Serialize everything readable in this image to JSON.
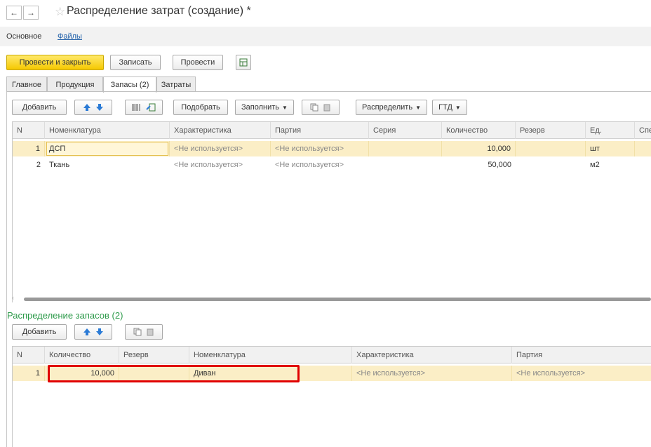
{
  "window": {
    "title": "Распределение затрат (создание) *"
  },
  "nav": {
    "back": "←",
    "forward": "→",
    "main_label": "Основное",
    "files_label": "Файлы"
  },
  "toolbar": {
    "post_close": "Провести и закрыть",
    "save": "Записать",
    "post": "Провести"
  },
  "tabs": [
    {
      "label": "Главное"
    },
    {
      "label": "Продукция"
    },
    {
      "label": "Запасы (2)"
    },
    {
      "label": "Затраты"
    }
  ],
  "stock_toolbar": {
    "add": "Добавить",
    "select": "Подобрать",
    "fill": "Заполнить",
    "distribute": "Распределить",
    "gtd": "ГТД"
  },
  "stock_table": {
    "columns": [
      "N",
      "Номенклатура",
      "Характеристика",
      "Партия",
      "Серия",
      "Количество",
      "Резерв",
      "Ед.",
      "Спе"
    ],
    "rows": [
      {
        "n": "1",
        "item": "ДСП",
        "char": "<Не используется>",
        "batch": "<Не используется>",
        "series": "",
        "qty": "10,000",
        "reserve": "",
        "unit": "шт"
      },
      {
        "n": "2",
        "item": "Ткань",
        "char": "<Не используется>",
        "batch": "<Не используется>",
        "series": "",
        "qty": "50,000",
        "reserve": "",
        "unit": "м2"
      }
    ]
  },
  "distribution": {
    "title": "Распределение запасов (2)",
    "add": "Добавить",
    "columns": [
      "N",
      "Количество",
      "Резерв",
      "Номенклатура",
      "Характеристика",
      "Партия"
    ],
    "rows": [
      {
        "n": "1",
        "qty": "10,000",
        "reserve": "",
        "item": "Диван",
        "char": "<Не используется>",
        "batch": "<Не используется>"
      }
    ]
  },
  "colors": {
    "accent_yellow": "#f5c800",
    "selection": "#fbeec6",
    "green_title": "#2d9a4a",
    "highlight_red": "#e00000",
    "link": "#1e5ea8"
  }
}
